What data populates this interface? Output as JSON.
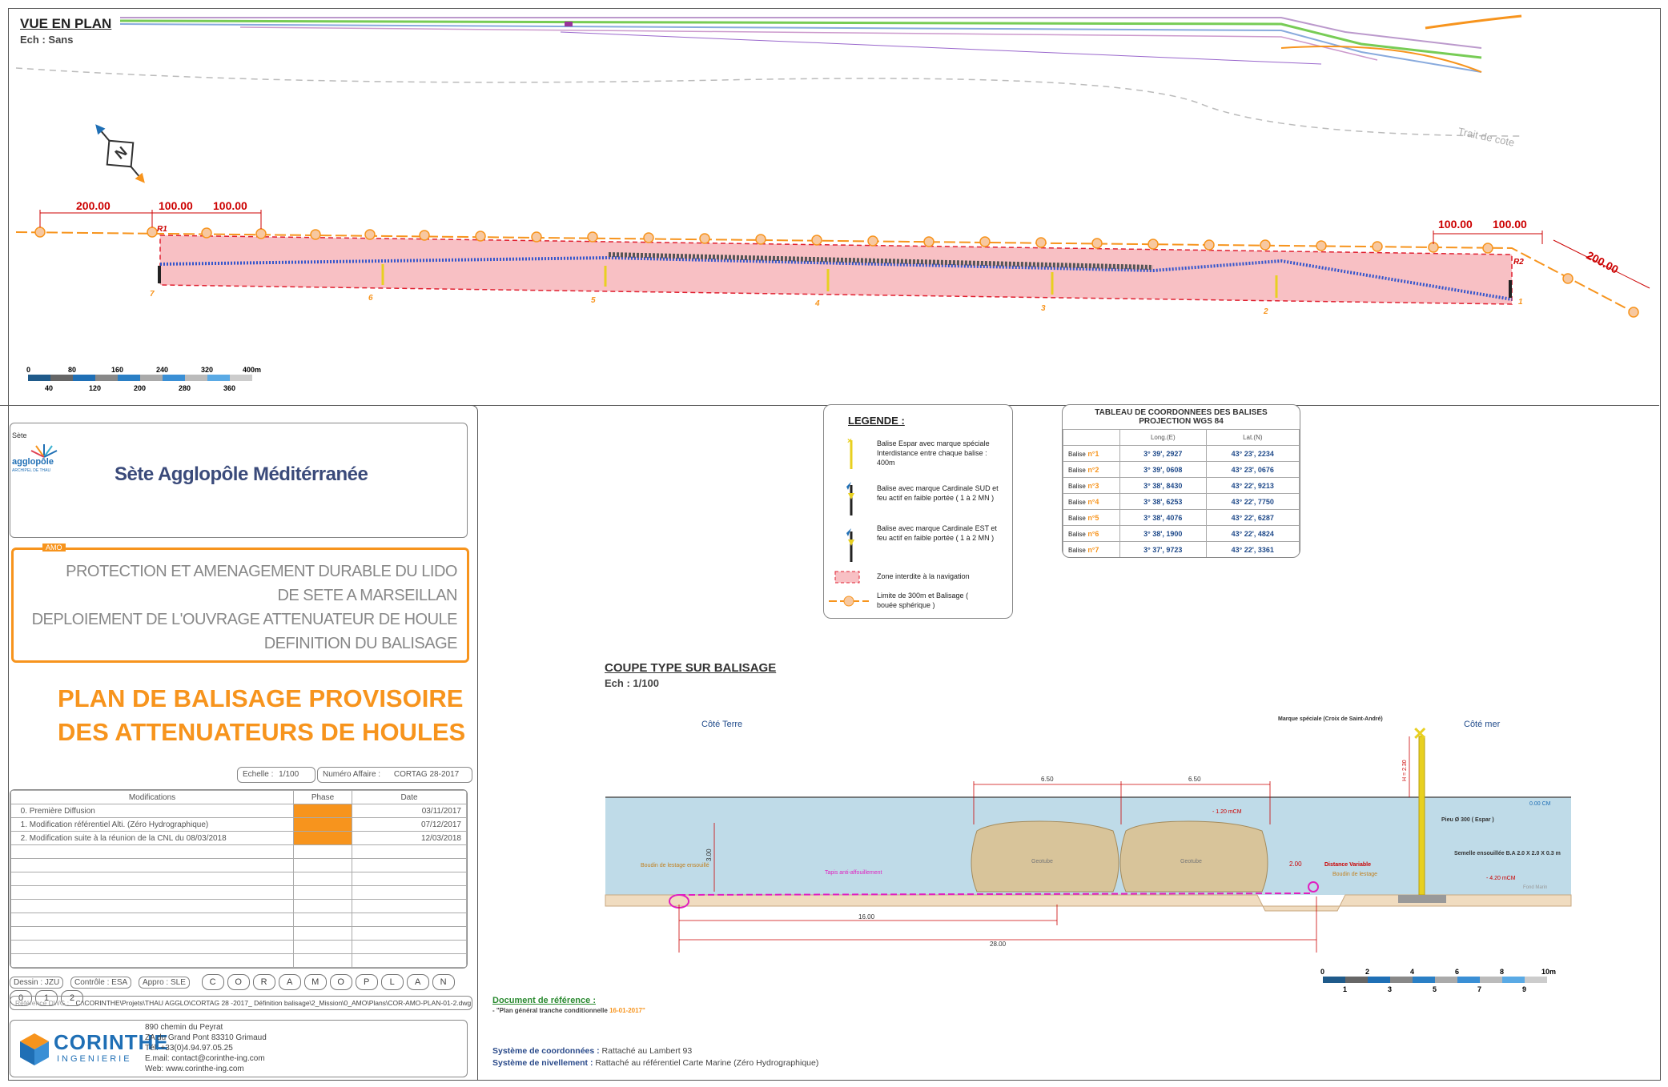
{
  "plan": {
    "title": "VUE EN PLAN",
    "scale": "Ech : Sans",
    "coast_label": "Trait de cote",
    "dimensions": [
      "200.00",
      "100.00",
      "100.00",
      "100.00",
      "100.00",
      "200.00"
    ],
    "markers": [
      "R1",
      "R2"
    ],
    "buoys": [
      "7",
      "6",
      "5",
      "4",
      "3",
      "2",
      "1"
    ],
    "scale_bar_top": [
      "0",
      "80",
      "160",
      "240",
      "320",
      "400m"
    ],
    "scale_bar_bottom": [
      "40",
      "120",
      "200",
      "280",
      "360"
    ]
  },
  "org": {
    "logo_top": "Sète",
    "logo_mid": "agglopôle",
    "logo_sub": "ARCHIPEL DE THAU",
    "name": "Sète Agglopôle Méditérranée"
  },
  "project": {
    "tag": "AMO",
    "lines": [
      "PROTECTION ET AMENAGEMENT DURABLE DU LIDO",
      "DE SETE A MARSEILLAN",
      "DEPLOIEMENT DE L'OUVRAGE ATTENUATEUR DE HOULE",
      "DEFINITION DU BALISAGE"
    ]
  },
  "plan_title": {
    "line1": "PLAN DE BALISAGE PROVISOIRE",
    "line2": "DES ATTENUATEURS DE HOULES"
  },
  "meta": {
    "echelle_label": "Echelle :",
    "echelle_value": "1/100",
    "affaire_label": "Numéro Affaire :",
    "affaire_value": "CORTAG 28-2017"
  },
  "modifications": {
    "headers": [
      "Modifications",
      "Phase",
      "Date"
    ],
    "rows": [
      {
        "num": "0.",
        "text": "Première Diffusion",
        "date": "03/11/2017"
      },
      {
        "num": "1.",
        "text": "Modification référentiel Alti. (Zéro Hydrographique)",
        "date": "07/12/2017"
      },
      {
        "num": "2.",
        "text": "Modification suite à la réunion de la CNL du 08/03/2018",
        "date": "12/03/2018"
      }
    ]
  },
  "signatures": {
    "dessin": "Dessin : JZU",
    "controle": "Contrôle : ESA",
    "appro": "Appro : SLE",
    "code": [
      "C",
      "O",
      "R",
      "A",
      "M",
      "O",
      "P",
      "L",
      "A",
      "N",
      "0",
      "1",
      "2"
    ]
  },
  "reference": {
    "label": "Référence DWG :",
    "path": "C:\\CORINTHE\\Projets\\THAU AGGLO\\CORTAG 28 -2017_ Définition balisage\\2_Mission\\0_AMO\\Plans\\COR-AMO-PLAN-01-2.dwg"
  },
  "company": {
    "name": "CORINTHE",
    "sub": "INGENIERIE",
    "address": [
      "890 chemin du Peyrat",
      "ZA du Grand Pont 83310 Grimaud",
      "Tél: +33(0)4.94.97.05.25",
      "E.mail: contact@corinthe-ing.com",
      "Web: www.corinthe-ing.com"
    ]
  },
  "legend": {
    "title": "LEGENDE :",
    "items": [
      "Balise Espar avec marque spéciale Interdistance entre chaque balise : 400m",
      "Balise avec marque Cardinale SUD et feu actif en faible portée ( 1 à 2 MN )",
      "Balise avec marque Cardinale EST et feu actif en faible portée ( 1 à 2 MN )",
      "Zone interdite à la navigation",
      "Limite de 300m et Balisage ( bouée sphérique )"
    ]
  },
  "coords": {
    "title1": "TABLEAU DE COORDONNEES DES BALISES",
    "title2": "PROJECTION WGS 84",
    "col_long": "Long.(E)",
    "col_lat": "Lat.(N)",
    "rows": [
      {
        "label": "Balise",
        "num": "n°1",
        "long": "3° 39', 2927",
        "lat": "43° 23', 2234"
      },
      {
        "label": "Balise",
        "num": "n°2",
        "long": "3° 39', 0608",
        "lat": "43° 23', 0676"
      },
      {
        "label": "Balise",
        "num": "n°3",
        "long": "3° 38', 8430",
        "lat": "43° 22', 9213"
      },
      {
        "label": "Balise",
        "num": "n°4",
        "long": "3° 38', 6253",
        "lat": "43° 22', 7750"
      },
      {
        "label": "Balise",
        "num": "n°5",
        "long": "3° 38', 4076",
        "lat": "43° 22', 6287"
      },
      {
        "label": "Balise",
        "num": "n°6",
        "long": "3° 38', 1900",
        "lat": "43° 22', 4824"
      },
      {
        "label": "Balise",
        "num": "n°7",
        "long": "3° 37', 9723",
        "lat": "43° 22', 3361"
      }
    ]
  },
  "section": {
    "title": "COUPE TYPE SUR BALISAGE",
    "scale": "Ech : 1/100",
    "cote_terre": "Côté Terre",
    "cote_mer": "Côté mer",
    "marque": "Marque spéciale (Croix de Saint-André)",
    "h_label": "H = 2.30",
    "dim_a": "6.50",
    "dim_b": "6.50",
    "level_0": "0.00 CM",
    "level_120": "- 1.20 mCM",
    "level_420": "- 4.20 mCM",
    "dim_300": "3.00",
    "dim_200": "2.00",
    "dist_var": "Distance Variable",
    "boudin_lestage": "Boudin de lestage",
    "boudin_ensouille": "Boudin de lestage ensouillé",
    "tapis": "Tapis anti-affouillement",
    "geotube": "Geotube",
    "pieu": "Pieu Ø 300 ( Espar )",
    "semelle": "Semelle ensouillée B.A 2.0 X 2.0 X 0.3 m",
    "fond": "Fond Marin",
    "dim_16": "16.00",
    "dim_28": "28.00",
    "scale_top": [
      "0",
      "2",
      "4",
      "6",
      "8",
      "10m"
    ],
    "scale_bottom": [
      "1",
      "3",
      "5",
      "7",
      "9"
    ]
  },
  "doc_ref": {
    "title": "Document de référence :",
    "text": "- \"Plan général tranche conditionnelle",
    "date": "16-01-2017\""
  },
  "systems": {
    "coord_label": "Système de coordonnées :",
    "coord_value": "Rattaché au Lambert 93",
    "nivel_label": "Système de nivellement :",
    "nivel_value": "Rattaché au référentiel Carte Marine (Zéro Hydrographique)"
  },
  "colors": {
    "orange": "#f7941d",
    "pink_zone": "#f8c0c4",
    "red_dim": "#cc0000",
    "water": "#bfdbe8",
    "navy": "#3a4a7a",
    "blue": "#1f6fb5"
  }
}
